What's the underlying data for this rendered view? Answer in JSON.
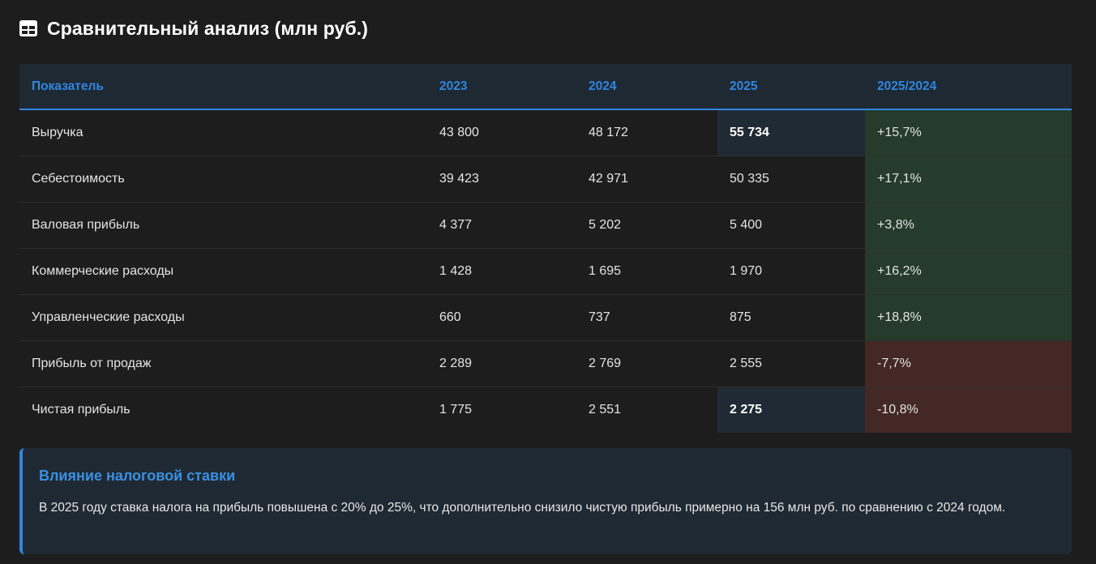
{
  "header": {
    "icon": "table-icon",
    "title": "Сравнительный анализ (млн руб.)"
  },
  "table": {
    "columns": [
      "Показатель",
      "2023",
      "2024",
      "2025",
      "2025/2024"
    ],
    "rows": [
      {
        "label": "Выручка",
        "y2023": "43 800",
        "y2024": "48 172",
        "y2025": "55 734",
        "change": "+15,7%",
        "highlight": true,
        "trend": "pos"
      },
      {
        "label": "Себестоимость",
        "y2023": "39 423",
        "y2024": "42 971",
        "y2025": "50 335",
        "change": "+17,1%",
        "highlight": false,
        "trend": "pos"
      },
      {
        "label": "Валовая прибыль",
        "y2023": "4 377",
        "y2024": "5 202",
        "y2025": "5 400",
        "change": "+3,8%",
        "highlight": false,
        "trend": "pos"
      },
      {
        "label": "Коммерческие расходы",
        "y2023": "1 428",
        "y2024": "1 695",
        "y2025": "1 970",
        "change": "+16,2%",
        "highlight": false,
        "trend": "pos"
      },
      {
        "label": "Управленческие расходы",
        "y2023": "660",
        "y2024": "737",
        "y2025": "875",
        "change": "+18,8%",
        "highlight": false,
        "trend": "pos"
      },
      {
        "label": "Прибыль от продаж",
        "y2023": "2 289",
        "y2024": "2 769",
        "y2025": "2 555",
        "change": "-7,7%",
        "highlight": false,
        "trend": "neg"
      },
      {
        "label": "Чистая прибыль",
        "y2023": "1 775",
        "y2024": "2 551",
        "y2025": "2 275",
        "change": "-10,8%",
        "highlight": true,
        "trend": "neg"
      }
    ]
  },
  "note": {
    "title": "Влияние налоговой ставки",
    "text": "В 2025 году ставка налога на прибыль повышена с 20% до 25%, что дополнительно снизило чистую прибыль примерно на 156 млн руб. по сравнению с 2024 годом."
  },
  "colors": {
    "accent": "#2f86e0",
    "positive_bg": "#263b2b",
    "negative_bg": "#432825",
    "highlight_bg": "#202a34",
    "page_bg": "#1d1d1d"
  }
}
